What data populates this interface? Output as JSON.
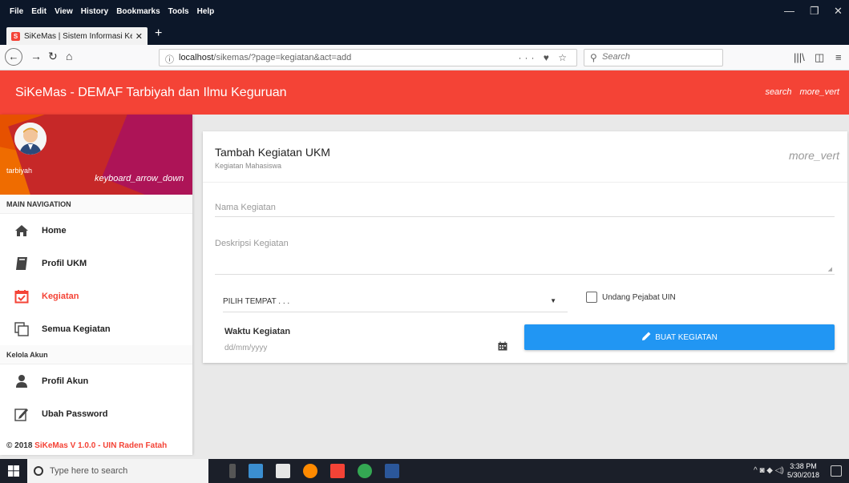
{
  "browser": {
    "menus": [
      "File",
      "Edit",
      "View",
      "History",
      "Bookmarks",
      "Tools",
      "Help"
    ],
    "tab_title": "SiKeMas | Sistem Informasi Keg",
    "url_host": "localhost",
    "url_path": "/sikemas/?page=kegiatan&act=add",
    "search_placeholder": "Search"
  },
  "header": {
    "title": "SiKeMas - DEMAF Tarbiyah dan Ilmu Keguruan",
    "search_label": "search",
    "more_label": "more_vert"
  },
  "user": {
    "name": "tarbiyah",
    "dropdown_label": "keyboard_arrow_down"
  },
  "sidebar": {
    "main_nav_header": "MAIN NAVIGATION",
    "items": [
      {
        "label": "Home",
        "icon": "home-icon"
      },
      {
        "label": "Profil UKM",
        "icon": "book-icon"
      },
      {
        "label": "Kegiatan",
        "icon": "calendar-check-icon",
        "active": true
      },
      {
        "label": "Semua Kegiatan",
        "icon": "copy-icon"
      }
    ],
    "account_header": "Kelola Akun",
    "account_items": [
      {
        "label": "Profil Akun",
        "icon": "user-icon"
      },
      {
        "label": "Ubah Password",
        "icon": "edit-icon"
      }
    ],
    "footer_prefix": "© 2018 ",
    "footer_highlight": "SiKeMas V 1.0.0 - UIN Raden Fatah"
  },
  "card": {
    "title": "Tambah Kegiatan UKM",
    "subtitle": "Kegiatan Mahasiswa",
    "more_label": "more_vert",
    "nama_placeholder": "Nama Kegiatan",
    "deskripsi_placeholder": "Deskripsi Kegiatan",
    "tempat_value": "PILIH TEMPAT . . .",
    "undang_label": "Undang Pejabat UIN",
    "waktu_label": "Waktu Kegiatan",
    "date_placeholder": "dd/mm/yyyy",
    "submit_label": "BUAT KEGIATAN"
  },
  "taskbar": {
    "search_placeholder": "Type here to search",
    "time": "3:38 PM",
    "date": "5/30/2018"
  },
  "colors": {
    "primary": "#f44336",
    "accent": "#2196f3"
  }
}
